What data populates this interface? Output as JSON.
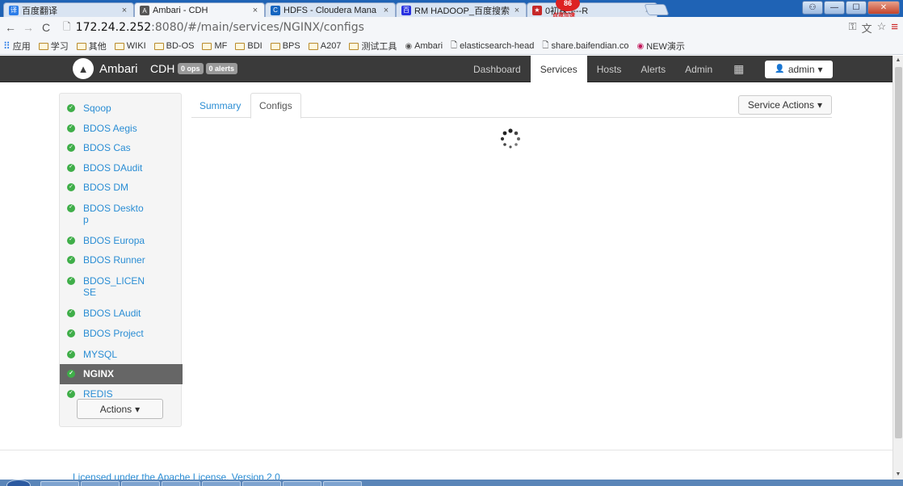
{
  "browser": {
    "tabs": [
      {
        "title": "百度翻译",
        "favicon": "translate-icon",
        "color": "#2b7de9",
        "glyph": "译"
      },
      {
        "title": "Ambari - CDH",
        "favicon": "ambari-icon",
        "color": "#555555",
        "glyph": "A",
        "active": true
      },
      {
        "title": "HDFS - Cloudera Mana",
        "favicon": "cloudera-icon",
        "color": "#1565c0",
        "glyph": "C"
      },
      {
        "title": "RM HADOOP_百度搜索",
        "favicon": "baidu-icon",
        "color": "#2932e1",
        "glyph": "百"
      },
      {
        "title": "0初探5---R",
        "favicon": "game-icon",
        "color": "#c62828",
        "glyph": "★"
      }
    ],
    "promo": {
      "count": "86",
      "text": "点我加速"
    },
    "url": {
      "host": "172.24.2.252",
      "path": ":8080/#/main/services/NGINX/configs"
    },
    "bookmarks": [
      {
        "label": "应用",
        "type": "apps"
      },
      {
        "label": "学习",
        "type": "folder"
      },
      {
        "label": "其他",
        "type": "folder"
      },
      {
        "label": "WIKI",
        "type": "folder"
      },
      {
        "label": "BD-OS",
        "type": "folder"
      },
      {
        "label": "MF",
        "type": "folder"
      },
      {
        "label": "BDI",
        "type": "folder"
      },
      {
        "label": "BPS",
        "type": "folder"
      },
      {
        "label": "A207",
        "type": "folder"
      },
      {
        "label": "测试工具",
        "type": "folder"
      },
      {
        "label": "Ambari",
        "type": "site"
      },
      {
        "label": "elasticsearch-head",
        "type": "page"
      },
      {
        "label": "share.baifendian.co",
        "type": "page"
      },
      {
        "label": "NEW演示",
        "type": "site"
      }
    ]
  },
  "navbar": {
    "brand": "Ambari",
    "cluster": "CDH",
    "ops_badge": "0 ops",
    "alerts_badge": "0 alerts",
    "links": [
      "Dashboard",
      "Services",
      "Hosts",
      "Alerts",
      "Admin"
    ],
    "active_link": "Services",
    "user": "admin"
  },
  "sidebar": {
    "services": [
      {
        "name": "Sqoop"
      },
      {
        "name": "BDOS Aegis"
      },
      {
        "name": "BDOS Cas"
      },
      {
        "name": "BDOS DAudit"
      },
      {
        "name": "BDOS DM"
      },
      {
        "name": "BDOS Desktop"
      },
      {
        "name": "BDOS Europa"
      },
      {
        "name": "BDOS Runner"
      },
      {
        "name": "BDOS_LICENSE"
      },
      {
        "name": "BDOS LAudit"
      },
      {
        "name": "BDOS Project"
      },
      {
        "name": "MYSQL"
      },
      {
        "name": "NGINX",
        "selected": true
      },
      {
        "name": "REDIS"
      }
    ],
    "status_color": "#3fae49",
    "actions_label": "Actions"
  },
  "main": {
    "tabs": [
      "Summary",
      "Configs"
    ],
    "active_tab": "Configs",
    "service_actions_label": "Service Actions"
  },
  "footer": {
    "license": "Licensed under the Apache License, Version 2.0."
  }
}
